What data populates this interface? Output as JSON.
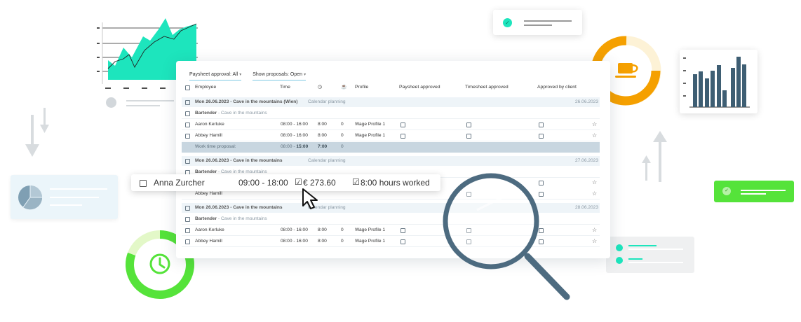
{
  "filters": {
    "paysheet_approval": "Paysheet approval: All",
    "show_proposals": "Show proposals: Open"
  },
  "columns": {
    "employee": "Employee",
    "time": "Time",
    "profile": "Profile",
    "paysheet_approved": "Paysheet approved",
    "timesheet_approved": "Timesheet approved",
    "approved_by_client": "Approved by client",
    "clock_icon": "clock-icon",
    "coffee_icon": "coffee-icon"
  },
  "groups": [
    {
      "day": "Mon 26.06.2023 - Cave in the mountains (Wien)",
      "planning": "Calendar planning",
      "date": "26.06.2023",
      "role": "Bartender",
      "location": "Cave in the mountains",
      "rows": [
        {
          "name": "Aaron Kerluke",
          "time": "08:00 - 16:00",
          "hours": "8:00",
          "break": "0",
          "profile": "Wage Profile 1"
        },
        {
          "name": "Abbey Hamill",
          "time": "08:00 - 16:00",
          "hours": "8:00",
          "break": "0",
          "profile": "Wage Profile 1"
        }
      ],
      "proposal": {
        "label": "Work time proposal:",
        "time_start": "08:00",
        "time_sep": " - ",
        "time_end": "15:00",
        "hours": "7:00",
        "break": "0"
      }
    },
    {
      "day": "Mon 26.06.2023 - Cave in the mountains",
      "planning": "Calendar planning",
      "date": "27.06.2023",
      "role": "Bartender",
      "location": "Cave in the mountains",
      "rows": [
        {
          "name": "Abbey Hamill",
          "time": "",
          "hours": "",
          "break": "",
          "profile": ""
        }
      ]
    },
    {
      "day": "Mon 26.06.2023 - Cave in the mountains",
      "planning": "Calendar planning",
      "date": "28.06.2023",
      "role": "Bartender",
      "location": "Cave in the mountains",
      "rows": [
        {
          "name": "Aaron Kerluke",
          "time": "08:00 - 16:00",
          "hours": "8:00",
          "break": "0",
          "profile": "Wage Profile 1"
        },
        {
          "name": "Abbey Hamill",
          "time": "08:00 - 16:00",
          "hours": "8:00",
          "break": "0",
          "profile": "Wage Profile 1"
        }
      ]
    }
  ],
  "floating_card": {
    "name": "Anna Zurcher",
    "time": "09:00 - 18:00",
    "amount": "€ 273.60",
    "hours": "8:00 hours worked"
  },
  "colors": {
    "teal": "#1de5bd",
    "steel": "#3e5e73",
    "orange": "#f5a000",
    "green": "#55e33a",
    "proposal_bg": "#c8d6e0",
    "day_bg": "#eef4f8"
  }
}
